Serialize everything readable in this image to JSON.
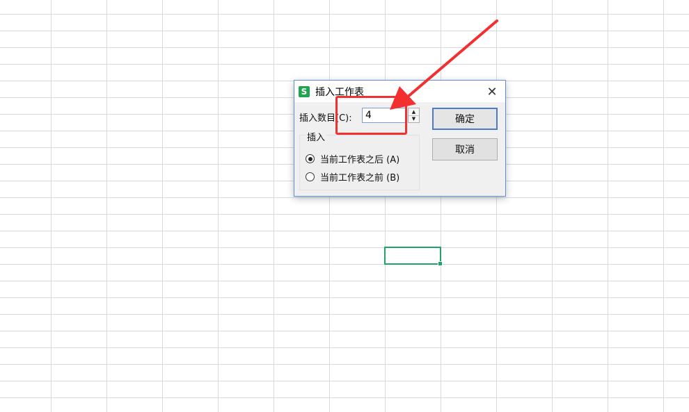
{
  "dialog": {
    "title": "插入工作表",
    "app_icon": "S",
    "count_label": "插入数目(C):",
    "count_value": "4",
    "group_label": "插入",
    "options": [
      {
        "label": "当前工作表之后 (A)",
        "checked": true
      },
      {
        "label": "当前工作表之前 (B)",
        "checked": false
      }
    ],
    "ok_label": "确定",
    "cancel_label": "取消",
    "close_glyph": "✕"
  },
  "colors": {
    "accent": "#21a366",
    "annotation": "#f23030",
    "dialog_border": "#5a8fd6"
  }
}
